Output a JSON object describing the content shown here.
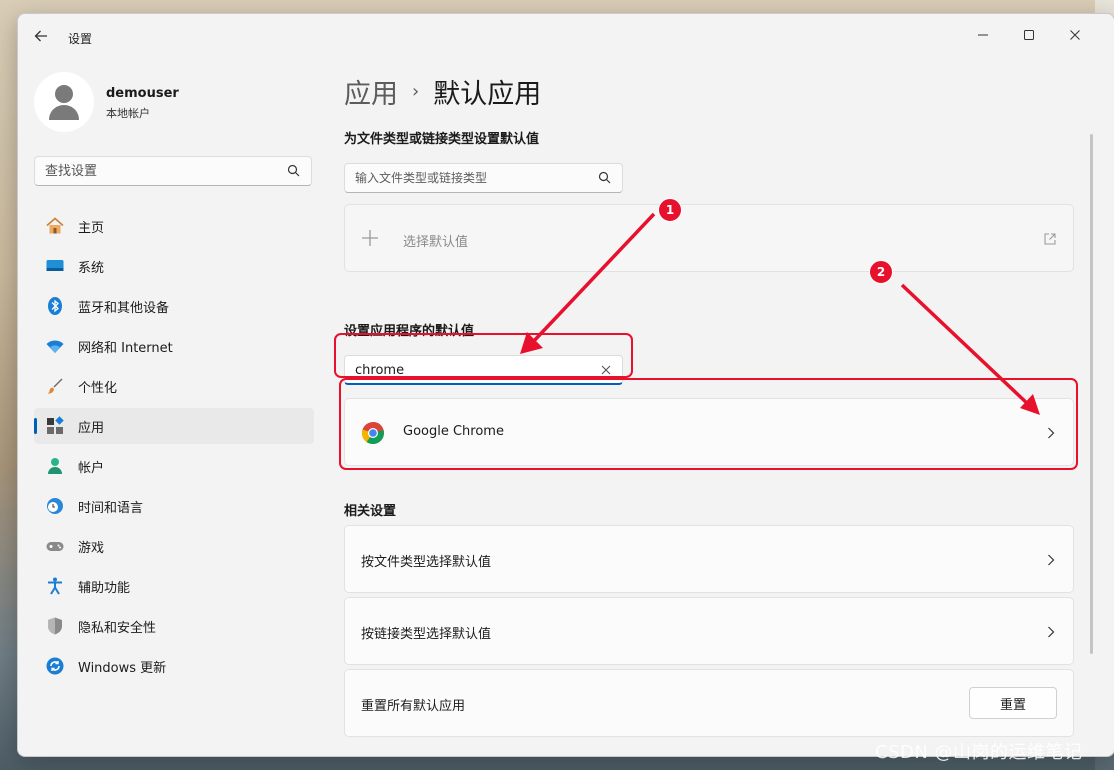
{
  "window": {
    "title": "设置"
  },
  "profile": {
    "name": "demouser",
    "account_type": "本地帐户"
  },
  "sidebar": {
    "search_placeholder": "查找设置",
    "items": [
      {
        "label": "主页",
        "icon": "home-icon"
      },
      {
        "label": "系统",
        "icon": "monitor-icon"
      },
      {
        "label": "蓝牙和其他设备",
        "icon": "bluetooth-icon"
      },
      {
        "label": "网络和 Internet",
        "icon": "wifi-icon"
      },
      {
        "label": "个性化",
        "icon": "brush-icon"
      },
      {
        "label": "应用",
        "icon": "apps-icon",
        "selected": true
      },
      {
        "label": "帐户",
        "icon": "person-icon"
      },
      {
        "label": "时间和语言",
        "icon": "clock-globe-icon"
      },
      {
        "label": "游戏",
        "icon": "gamepad-icon"
      },
      {
        "label": "辅助功能",
        "icon": "accessibility-icon"
      },
      {
        "label": "隐私和安全性",
        "icon": "shield-icon"
      },
      {
        "label": "Windows 更新",
        "icon": "update-icon"
      }
    ]
  },
  "breadcrumb": {
    "parent": "应用",
    "separator": "›",
    "current": "默认应用"
  },
  "filetype_section": {
    "heading": "为文件类型或链接类型设置默认值",
    "search_placeholder": "输入文件类型或链接类型",
    "choose_default_label": "选择默认值"
  },
  "apps_section": {
    "heading": "设置应用程序的默认值",
    "search_value": "chrome",
    "result_label": "Google Chrome"
  },
  "related": {
    "heading": "相关设置",
    "items": [
      {
        "label": "按文件类型选择默认值"
      },
      {
        "label": "按链接类型选择默认值"
      },
      {
        "label": "重置所有默认应用",
        "button": "重置"
      }
    ]
  },
  "annotations": {
    "badge1": "1",
    "badge2": "2",
    "color": "#e8112d"
  },
  "accent_color": "#005fb8",
  "watermark": "CSDN @山岗的运维笔记"
}
